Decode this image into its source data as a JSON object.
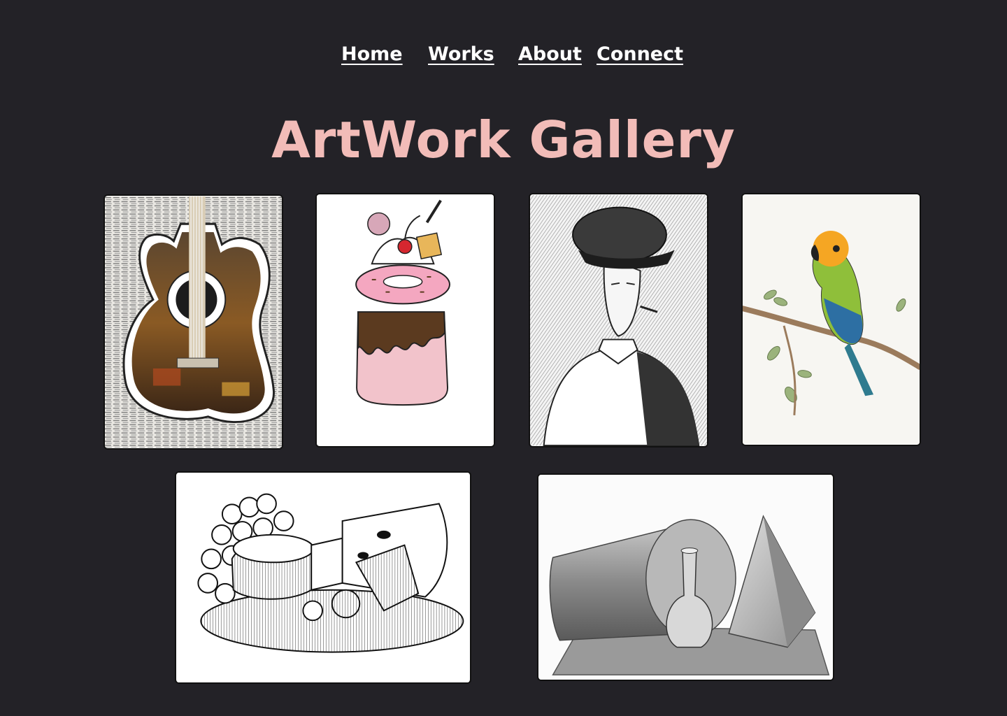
{
  "nav": {
    "items": [
      {
        "label": "Home"
      },
      {
        "label": "Works"
      },
      {
        "label": "About"
      },
      {
        "label": "Connect"
      }
    ]
  },
  "page": {
    "title": "ArtWork Gallery"
  },
  "colors": {
    "background": "#232227",
    "title": "#f2bcb8",
    "nav_text": "#ffffff",
    "card_bg": "#ffffff"
  },
  "gallery": {
    "artworks": [
      {
        "subject": "guitar-collage"
      },
      {
        "subject": "freakshake-jar"
      },
      {
        "subject": "man-in-flat-cap-portrait"
      },
      {
        "subject": "parrot-on-branch"
      },
      {
        "subject": "cheese-and-grapes-still-life"
      },
      {
        "subject": "geometric-shapes-still-life"
      }
    ]
  }
}
